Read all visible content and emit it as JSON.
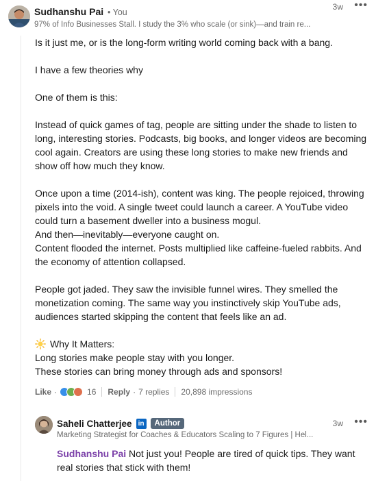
{
  "comment": {
    "author": "Sudhanshu Pai",
    "author_meta": "• You",
    "headline": "97% of Info Businesses Stall. I study the 3% who scale (or sink)—and train re...",
    "time": "3w",
    "more_icon": "more-horizontal-icon",
    "paragraphs": [
      "Is it just me, or is the long-form writing world coming back with a bang.",
      "I have a few theories why",
      "One of them is this:",
      "Instead of quick games of tag, people are sitting under the shade to listen to long, interesting stories. Podcasts, big books, and longer videos are becoming cool again. Creators are using these long stories to make new friends and show off how much they know.",
      "Once upon a time (2014-ish), content was king. The people rejoiced, throwing pixels into the void. A single tweet could launch a career. A YouTube video could turn a basement dweller into a business mogul.",
      "And then—inevitably—everyone caught on.",
      "Content flooded the internet. Posts multiplied like caffeine-fueled rabbits. And the economy of attention collapsed.",
      "People got jaded. They saw the invisible funnel wires. They smelled the monetization coming. The same way you instinctively skip YouTube ads, audiences started skipping the content that feels like an ad.",
      "Why It Matters:",
      "Long stories make people stay with you longer.",
      "These stories can bring money through ads and sponsors!"
    ],
    "actions": {
      "like": "Like",
      "reaction_count": "16",
      "reply": "Reply",
      "replies": "7 replies",
      "impressions": "20,898 impressions"
    }
  },
  "reply": {
    "author": "Saheli Chatterjee",
    "linkedin_badge": "in",
    "author_badge": "Author",
    "headline": "Marketing Strategist for Coaches & Educators Scaling to 7 Figures | Hel...",
    "time": "3w",
    "mention": "Sudhanshu Pai",
    "text": "Not just you! People are tired of quick tips. They want real stories that stick with them!"
  },
  "colors": {
    "mention": "#7a3fa8",
    "linkedin_blue": "#0a66c2",
    "author_badge_bg": "#56687a",
    "like_reaction": "#378fe9",
    "celebrate_reaction": "#6dae4f",
    "love_reaction": "#df704d"
  }
}
